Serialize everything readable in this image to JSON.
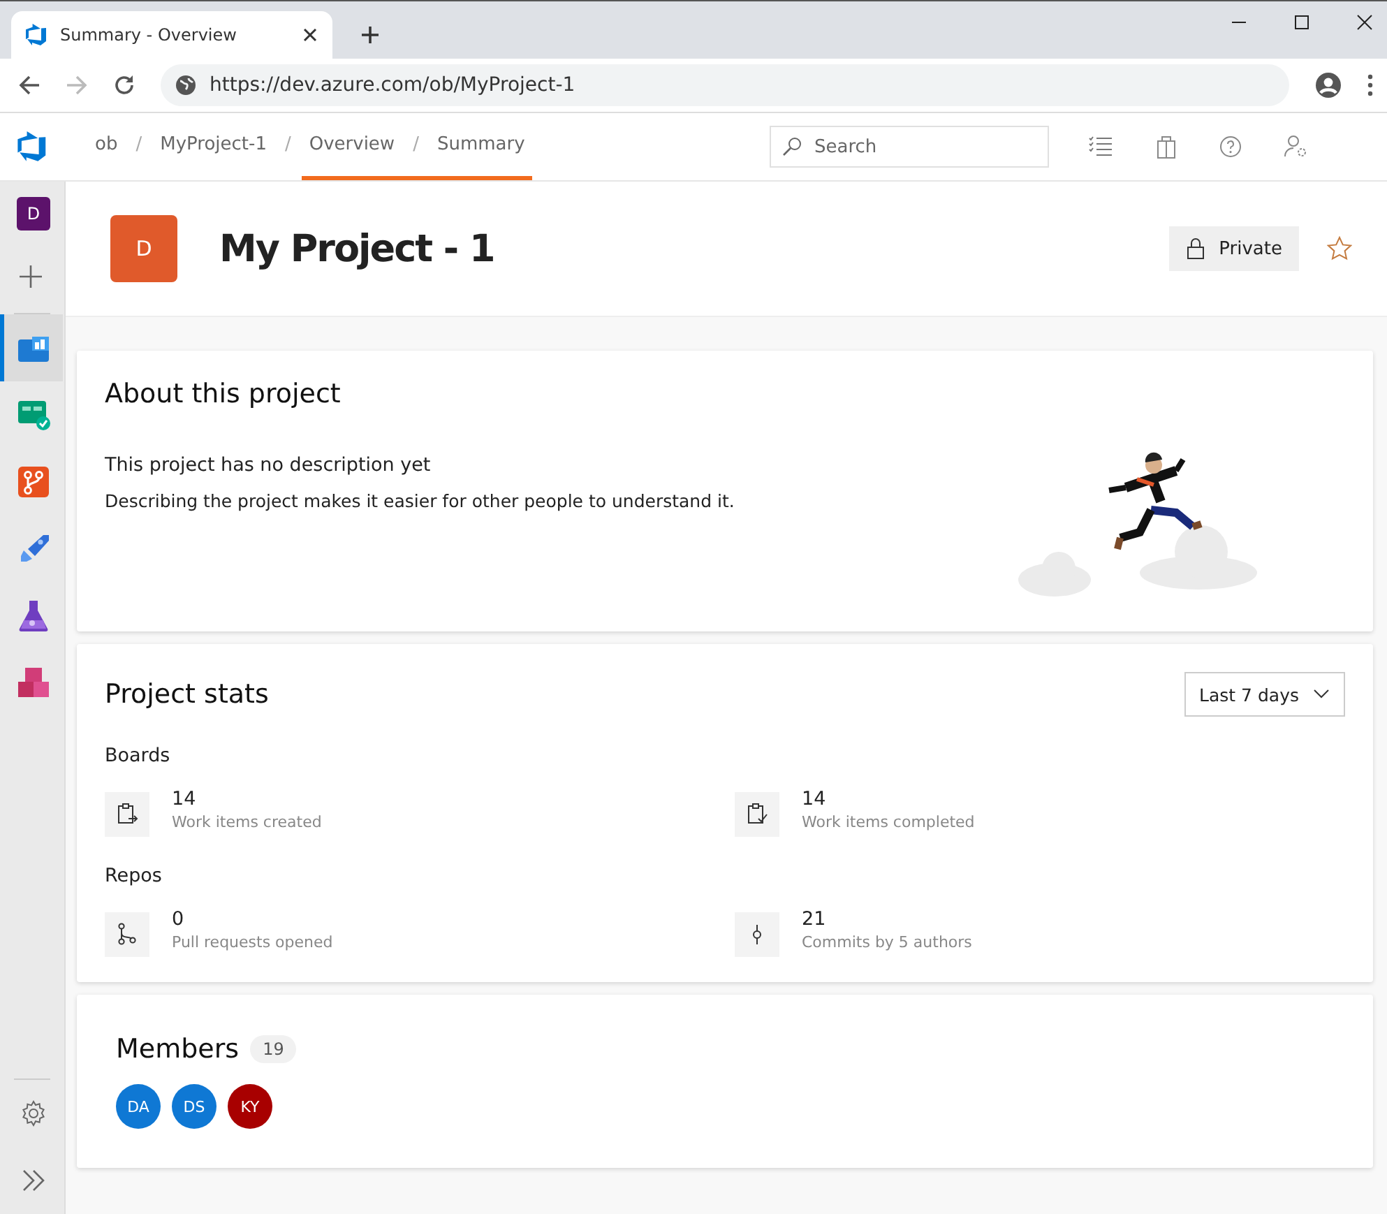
{
  "browser": {
    "tab_title": "Summary - Overview",
    "url": "https://dev.azure.com/ob/MyProject-1"
  },
  "breadcrumb": [
    {
      "label": "ob",
      "separator": "/",
      "selected": false
    },
    {
      "label": "MyProject-1",
      "separator": "/",
      "selected": false
    },
    {
      "label": "Overview",
      "separator": "/",
      "selected": true
    },
    {
      "label": "Summary",
      "selected": true
    }
  ],
  "search": {
    "placeholder": "Search"
  },
  "sidebar": {
    "items": [
      {
        "kind": "org",
        "label": "D",
        "selected": false
      },
      {
        "kind": "add",
        "selected": false
      },
      {
        "kind": "overview",
        "selected": true
      },
      {
        "kind": "boards",
        "selected": false
      },
      {
        "kind": "repos",
        "selected": false
      },
      {
        "kind": "pipelines",
        "selected": false
      },
      {
        "kind": "testplans",
        "selected": false
      },
      {
        "kind": "artifacts",
        "selected": false
      }
    ],
    "footer": [
      {
        "kind": "settings"
      },
      {
        "kind": "expand"
      }
    ]
  },
  "project": {
    "avatar": "D",
    "name": "My Project - 1",
    "visibility": "Private",
    "favorite": false
  },
  "about": {
    "title": "About this project",
    "subtitle": "This project has no description yet",
    "text": "Describing the project makes it easier for other people to understand it."
  },
  "stats": {
    "title": "Project stats",
    "period": "Last 7 days",
    "sections": [
      {
        "title": "Boards",
        "items": [
          {
            "kind": "created",
            "value": "14",
            "label": "Work items created"
          },
          {
            "kind": "completed",
            "value": "14",
            "label": "Work items completed"
          }
        ]
      },
      {
        "title": "Repos",
        "items": [
          {
            "kind": "pullrequest",
            "value": "0",
            "label": "Pull requests opened"
          },
          {
            "kind": "commit",
            "value": "21",
            "label": "Commits by 5 authors"
          }
        ]
      }
    ]
  },
  "members": {
    "title": "Members",
    "count": "19",
    "avatars": [
      {
        "initials": "DA",
        "color": "#0f78d4"
      },
      {
        "initials": "DS",
        "color": "#0f78d4"
      },
      {
        "initials": "KY",
        "color": "#a80000"
      }
    ]
  }
}
